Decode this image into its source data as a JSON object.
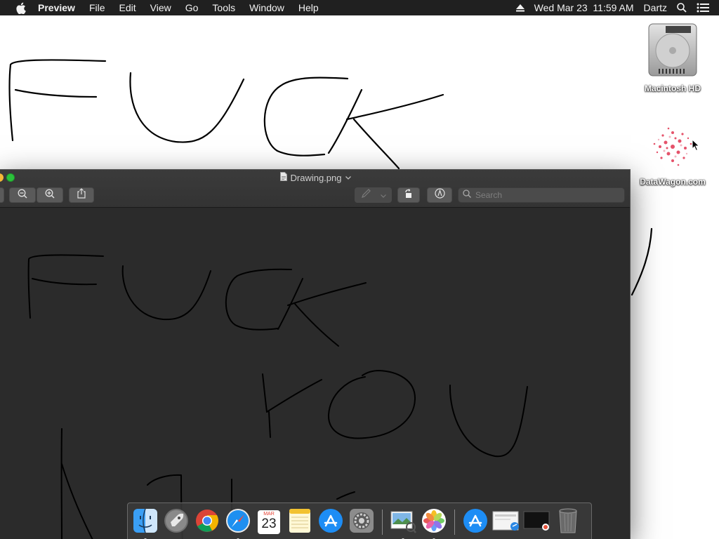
{
  "menubar": {
    "app_name": "Preview",
    "items": [
      "File",
      "Edit",
      "View",
      "Go",
      "Tools",
      "Window",
      "Help"
    ],
    "clock": "Wed Mar 23  11:59 AM",
    "user": "Dartz"
  },
  "desktop": {
    "icons": [
      {
        "label": "Macintosh HD",
        "icon": "hard-drive-icon"
      },
      {
        "label": "DataWagon.com",
        "icon": "datawagon-icon"
      }
    ],
    "drawing_text": "FUCK"
  },
  "window": {
    "title": "Drawing.png",
    "search_placeholder": "Search",
    "toolbar": [
      "zoom-out-icon",
      "zoom-in-icon",
      "share-icon",
      "pen-icon",
      "rotate-icon",
      "markup-icon"
    ],
    "drawing_text": [
      "FUCK",
      "YOU"
    ]
  },
  "dock": {
    "calendar_month": "MAR",
    "calendar_day": "23",
    "apps": [
      "Finder",
      "Launchpad",
      "Chrome",
      "Safari",
      "Calendar",
      "Notes",
      "App Store",
      "System Preferences",
      "Preview",
      "Photos",
      "App Store",
      "Downloads",
      "Screen",
      "Trash"
    ]
  },
  "colors": {
    "menubar_bg": "#202020",
    "window_bg": "#2b2b2b",
    "traffic_green": "#2bc13b"
  }
}
